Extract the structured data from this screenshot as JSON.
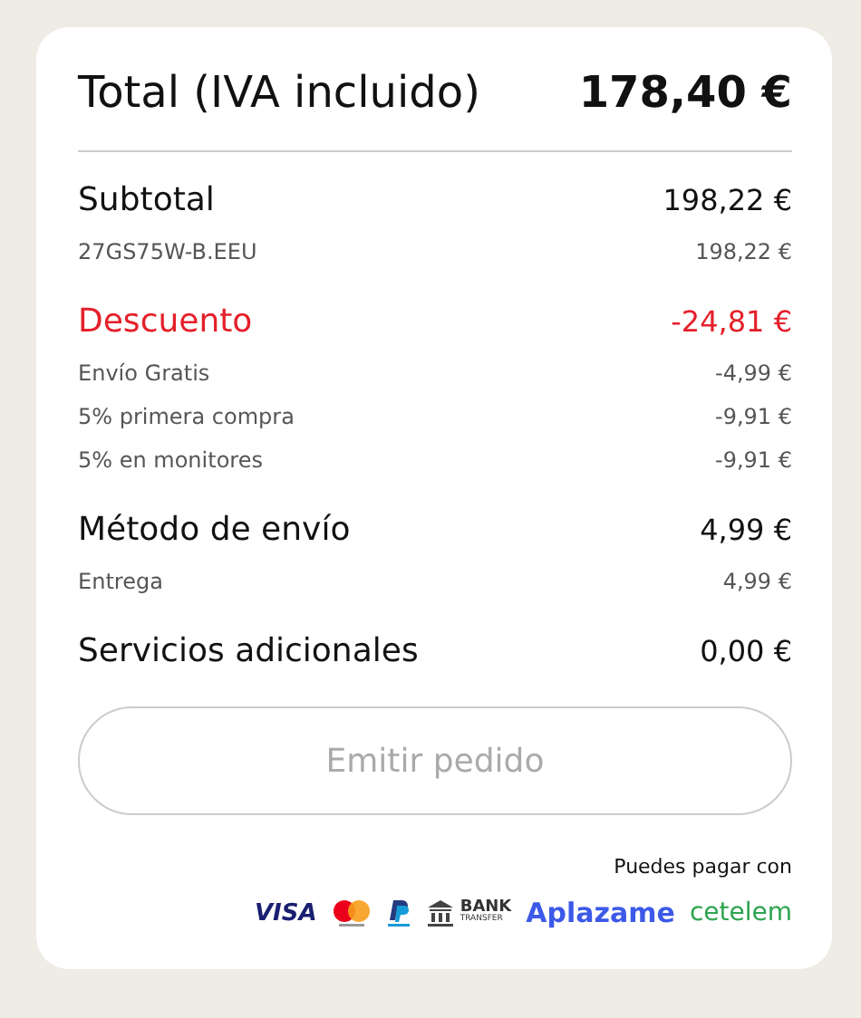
{
  "total": {
    "label": "Total (IVA incluido)",
    "amount": "178,40 €"
  },
  "sections": [
    {
      "kind": "normal",
      "title": "Subtotal",
      "amount": "198,22 €",
      "items": [
        {
          "label": "27GS75W-B.EEU",
          "amount": "198,22 €"
        }
      ]
    },
    {
      "kind": "discount",
      "title": "Descuento",
      "amount": "-24,81 €",
      "items": [
        {
          "label": "Envío Gratis",
          "amount": "-4,99 €"
        },
        {
          "label": "5% primera compra",
          "amount": "-9,91 €"
        },
        {
          "label": "5% en monitores",
          "amount": "-9,91 €"
        }
      ]
    },
    {
      "kind": "normal",
      "title": "Método de envío",
      "amount": "4,99 €",
      "items": [
        {
          "label": "Entrega",
          "amount": "4,99 €"
        }
      ]
    },
    {
      "kind": "normal",
      "title": "Servicios adicionales",
      "amount": "0,00 €"
    }
  ],
  "order_button": {
    "label": "Emitir pedido",
    "disabled": true
  },
  "payment": {
    "caption": "Puedes pagar con",
    "methods": [
      {
        "kind": "visa",
        "text": "VISA"
      },
      {
        "kind": "mastercard"
      },
      {
        "kind": "paypal"
      },
      {
        "kind": "bank",
        "text": "BANK",
        "subtext": "TRANSFER"
      },
      {
        "kind": "aplazame",
        "text": "Aplazame"
      },
      {
        "kind": "cetelem",
        "text": "cetelem"
      }
    ]
  }
}
